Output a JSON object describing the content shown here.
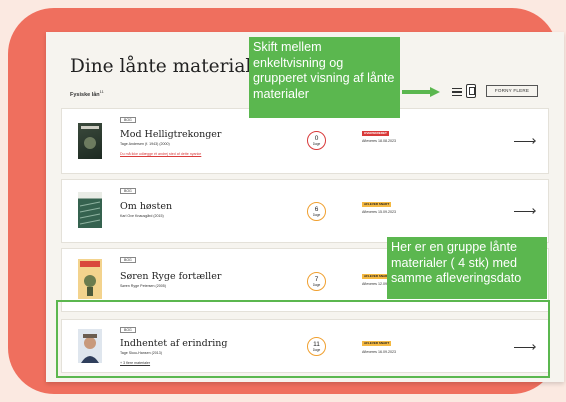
{
  "page": {
    "title": "Dine lånte materialer",
    "subtitle_label": "Fysiske lån",
    "subtitle_count": "11",
    "renew_button": "FORNY FLERE",
    "view_list_icon": "list-icon",
    "view_group_icon": "grouped-view-icon"
  },
  "loans": [
    {
      "badge": "BOG",
      "title": "Mod Helligtrekonger",
      "author": "Tage Andersen (f. 1943) (2000)",
      "note": "Du må ikke udlægge ét andrej sted af dette nyanke",
      "days": "0",
      "days_label": "Dage",
      "status": "OVERSKREDET",
      "status_color": "#d93a3a",
      "due": "Afleveres 18.08.2023",
      "ring_color": "#d93a3a"
    },
    {
      "badge": "BOG",
      "title": "Om høsten",
      "author": "Karl Ove Knausgård (2015)",
      "days": "6",
      "days_label": "Dage",
      "status": "AFLEVER SNART",
      "status_color": "#f5b942",
      "due": "Afleveres 15.09.2023",
      "ring_color": "#f0a030"
    },
    {
      "badge": "BOG",
      "title": "Søren Ryge fortæller",
      "author": "Søren Ryge Petersen (2005)",
      "days": "7",
      "days_label": "Dage",
      "status": "AFLEVER SNART",
      "status_color": "#f5b942",
      "due": "Afleveres 12.09.2023",
      "ring_color": "#f0a030"
    },
    {
      "badge": "BOG",
      "title": "Indhentet af erindring",
      "author": "Tage Skou-Hansen (2013)",
      "note": "+ 3 flere materialer",
      "days": "11",
      "days_label": "Dage",
      "status": "AFLEVER SNART",
      "status_color": "#f5b942",
      "due": "Afleveres 16.09.2023",
      "ring_color": "#f0a030"
    }
  ],
  "callouts": {
    "view_toggle": "Skift mellem enkeltvisning og grupperet visning af lånte materialer",
    "group": "Her er en gruppe lånte materialer ( 4 stk) med samme afleveringsdato"
  },
  "colors": {
    "frame": "#ef6f5e",
    "callout": "#5bb74f",
    "panel": "#f6f4ef"
  }
}
